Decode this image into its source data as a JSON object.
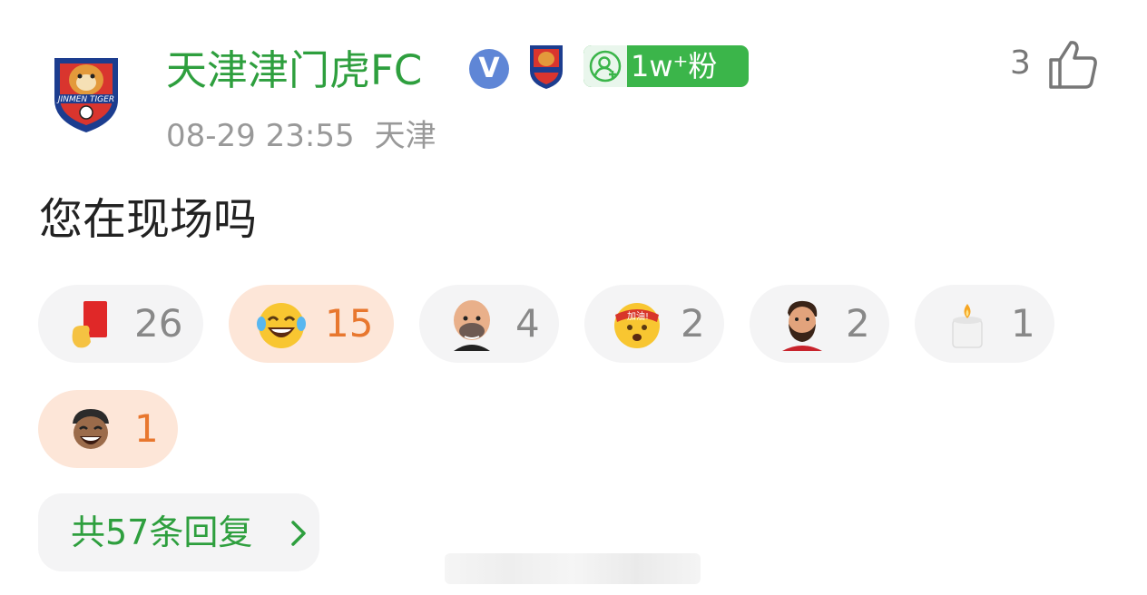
{
  "post": {
    "username": "天津津门虎FC",
    "verified_badge": "V",
    "fan_badge": "1w⁺粉",
    "like_count": "3",
    "time": "08-29 23:55",
    "location": "天津",
    "content": "您在现场吗"
  },
  "reactions": [
    {
      "icon": "red-card-icon",
      "count": "26",
      "active": false
    },
    {
      "icon": "laughing-tears-icon",
      "count": "15",
      "active": true
    },
    {
      "icon": "bald-face-sticker-icon",
      "count": "4",
      "active": false
    },
    {
      "icon": "cheer-jiayou-sticker-icon",
      "count": "2",
      "active": false
    },
    {
      "icon": "bearded-player-sticker-icon",
      "count": "2",
      "active": false
    },
    {
      "icon": "candle-icon",
      "count": "1",
      "active": false
    },
    {
      "icon": "laughing-cap-sticker-icon",
      "count": "1",
      "active": true
    }
  ],
  "reaction_badge_text": "加油!",
  "replies_label": "共57条回复",
  "colors": {
    "username": "#2e9f3e",
    "fan_badge": "#3bb54a",
    "active_pill": "#fde6d8",
    "active_count": "#e8772e"
  }
}
